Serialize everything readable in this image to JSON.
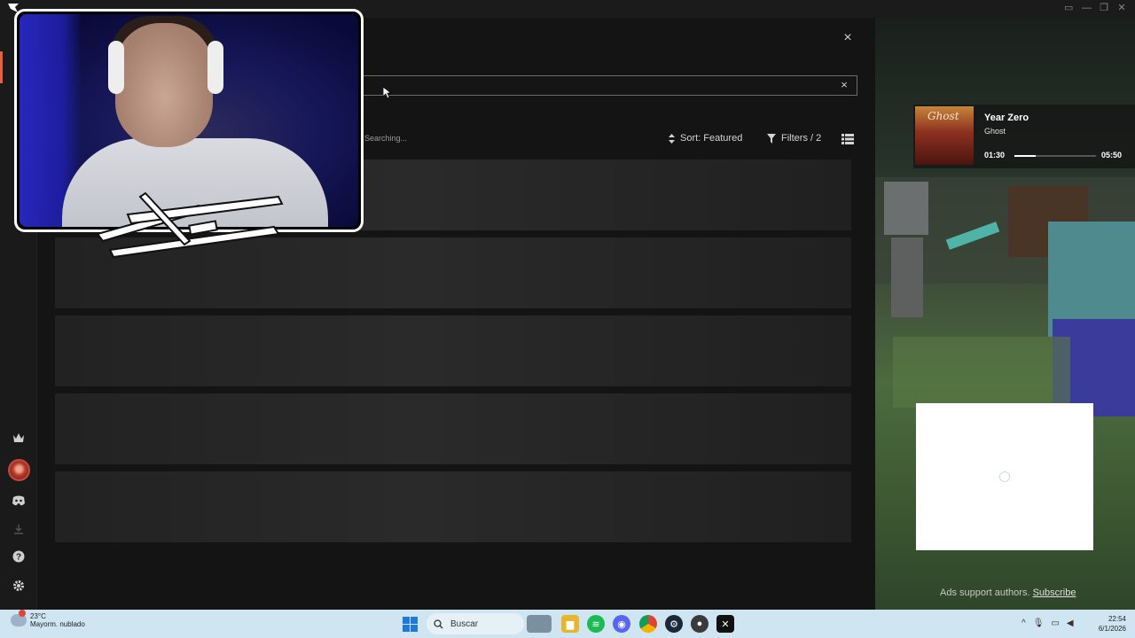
{
  "window": {
    "title": "",
    "controls": [
      "▭",
      "—",
      "❐",
      "✕"
    ]
  },
  "rail": {
    "icons": [
      "crown-icon",
      "avatar",
      "discord-icon",
      "download-icon",
      "help-icon",
      "settings-icon"
    ]
  },
  "modal": {
    "close_label": "×",
    "search": {
      "value": "",
      "clear_label": "×"
    },
    "status": "Searching...",
    "sort_label": "Sort: Featured",
    "filters_label": "Filters / 2",
    "rows": 5
  },
  "music": {
    "title": "Year Zero",
    "artist": "Ghost",
    "album_text": "Ghost",
    "time_current": "01:30",
    "time_total": "05:50",
    "progress": 0.26
  },
  "ads": {
    "text": "Ads support authors. ",
    "link": "Subscribe"
  },
  "taskbar": {
    "weather_temp": "23°C",
    "weather_desc": "Mayorm. nublado",
    "search_placeholder": "Buscar",
    "time": "22:54",
    "date": "6/1/2026"
  },
  "colors": {
    "accent": "#e8603c",
    "taskbar": "#cfe6f2",
    "windows_blue": "#1e7ad6",
    "spotify_green": "#1db954"
  }
}
